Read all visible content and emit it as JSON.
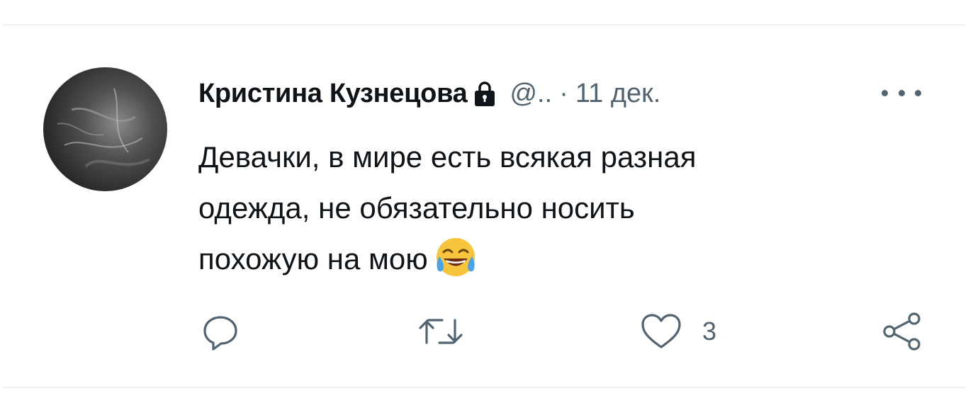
{
  "tweet": {
    "author": {
      "display_name": "Кристина Кузнецова",
      "handle": "@..",
      "protected_icon": "lock-icon",
      "avatar_icon": "avatar"
    },
    "separator": "·",
    "date": "11 дек.",
    "more_icon": "more-icon",
    "text_lines": [
      "Девачки, в мире есть всякая разная",
      "одежда, не обязательно носить",
      "похожую на мою"
    ],
    "emoji": "face-with-tears-of-joy-emoji",
    "actions": {
      "reply": {
        "icon": "reply-icon"
      },
      "retweet": {
        "icon": "retweet-icon"
      },
      "like": {
        "icon": "heart-icon",
        "count": "3"
      },
      "share": {
        "icon": "share-icon"
      }
    }
  },
  "colors": {
    "text_primary": "#0f1419",
    "text_secondary": "#536471",
    "divider": "#eff1f3"
  }
}
